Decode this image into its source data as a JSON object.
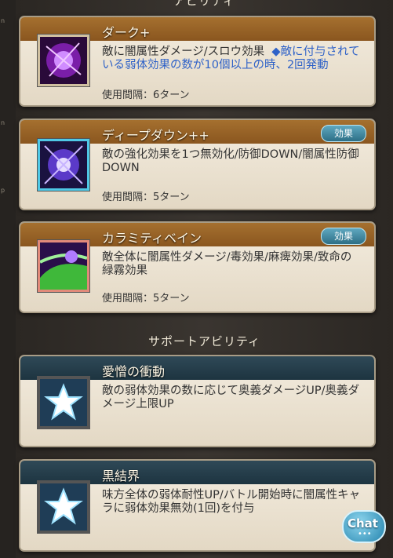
{
  "sidebar": {
    "tick1": "n",
    "tick2": "n",
    "tick3": "p"
  },
  "sections": {
    "ability_header": "アビリティ",
    "support_header": "サポートアビリティ"
  },
  "abilities": [
    {
      "name": "ダーク+",
      "desc": "敵に闇属性ダメージ/スロウ効果",
      "desc_highlight": "◆敵に付与されている弱体効果の数が10個以上の時、2回発動",
      "cooldown": "使用間隔：6ターン",
      "icon": "dark-orb-icon"
    },
    {
      "name": "ディープダウン++",
      "desc": "敵の強化効果を1つ無効化/防御DOWN/闇属性防御DOWN",
      "cooldown": "使用間隔：5ターン",
      "effect_button": "効果",
      "icon": "deep-down-icon"
    },
    {
      "name": "カラミティベイン",
      "desc": "敵全体に闇属性ダメージ/毒効果/麻痺効果/致命の緑霧効果",
      "cooldown": "使用間隔：5ターン",
      "effect_button": "効果",
      "icon": "calamity-bane-icon"
    }
  ],
  "support": [
    {
      "name": "愛憎の衝動",
      "desc": "敵の弱体効果の数に応じて奥義ダメージUP/奥義ダメージ上限UP",
      "icon": "star-icon"
    },
    {
      "name": "黒結界",
      "desc": "味方全体の弱体耐性UP/バトル開始時に闇属性キャラに弱体効果無効(1回)を付与",
      "icon": "star-icon"
    }
  ],
  "chat": {
    "label": "Chat",
    "dots": "•••"
  }
}
